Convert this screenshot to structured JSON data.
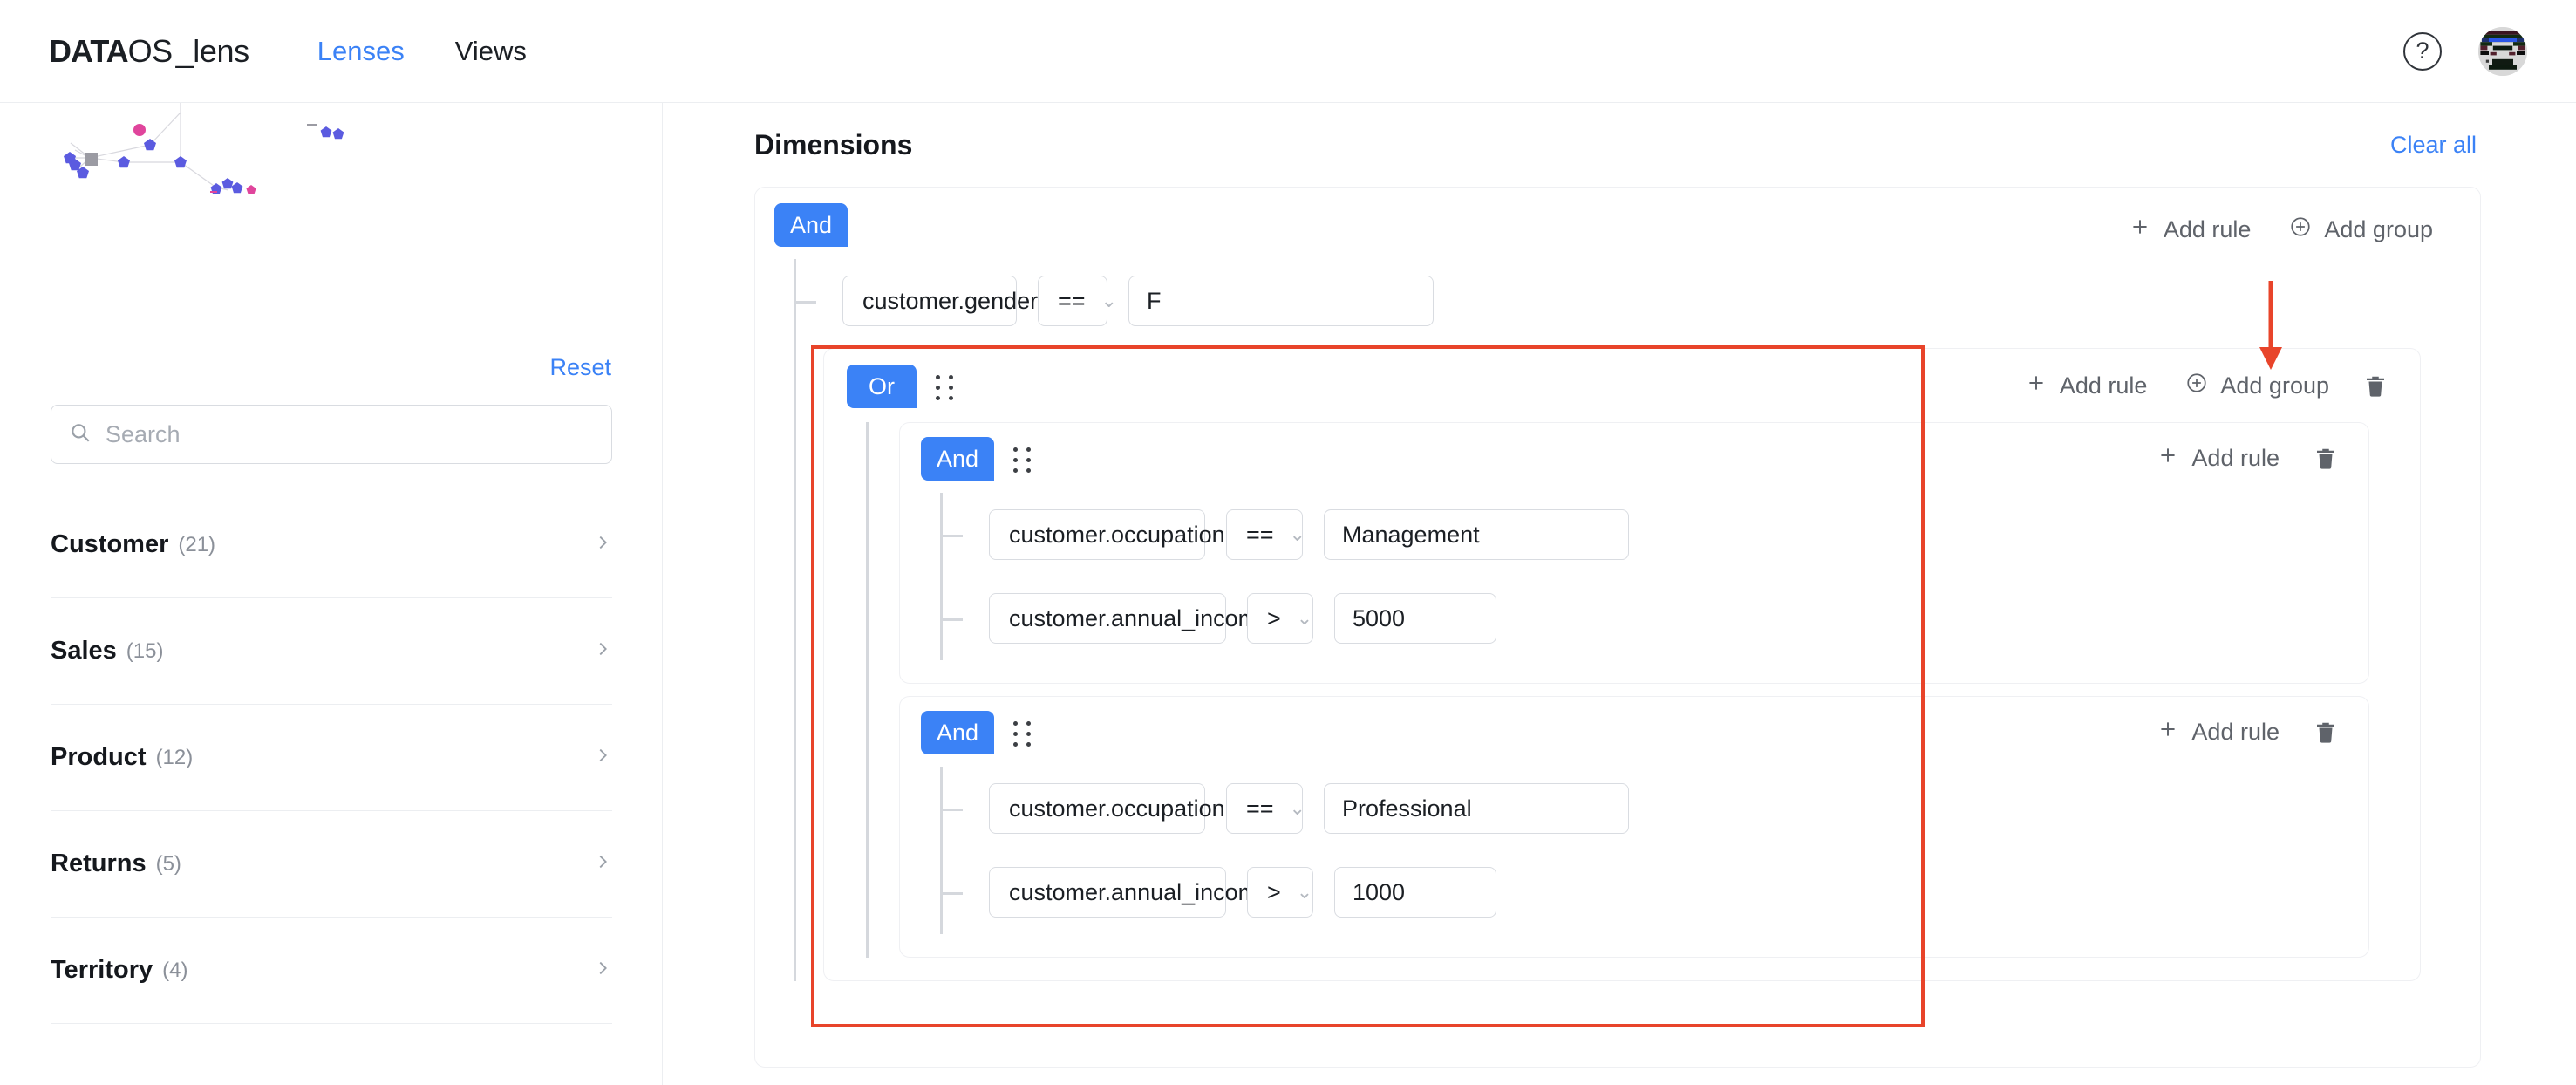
{
  "header": {
    "brand": {
      "data": "DATA",
      "os": "OS",
      "lens": "_lens"
    },
    "nav": [
      {
        "label": "Lenses",
        "active": true
      },
      {
        "label": "Views",
        "active": false
      }
    ],
    "help_icon": "question-mark-circle-icon",
    "help_glyph": "?",
    "avatar_icon": "user-avatar-identicon"
  },
  "sidebar": {
    "reset_label": "Reset",
    "search": {
      "placeholder": "Search",
      "value": "",
      "icon": "search-icon"
    },
    "items": [
      {
        "label": "Customer",
        "count": "(21)"
      },
      {
        "label": "Sales",
        "count": "(15)"
      },
      {
        "label": "Product",
        "count": "(12)"
      },
      {
        "label": "Returns",
        "count": "(5)"
      },
      {
        "label": "Territory",
        "count": "(4)"
      }
    ],
    "chevron_icon": "chevron-right-icon"
  },
  "main": {
    "title": "Dimensions",
    "clear_all_label": "Clear all",
    "labels": {
      "add_rule": "Add rule",
      "add_group": "Add group",
      "plus_icon": "plus-icon",
      "plus_circle_icon": "plus-circle-icon",
      "trash_icon": "trash-icon",
      "drag_icon": "drag-handle-icon",
      "caret_icon": "chevron-down-icon"
    },
    "root_group": {
      "operator": "And",
      "rules": [
        {
          "field": "customer.gender",
          "operator": "==",
          "value": "F",
          "value_type": "text"
        }
      ]
    },
    "or_group": {
      "operator": "Or",
      "subgroups": [
        {
          "operator": "And",
          "rules": [
            {
              "field": "customer.occupation",
              "operator": "==",
              "value": "Management",
              "value_type": "text"
            },
            {
              "field": "customer.annual_income",
              "operator": ">",
              "value": "5000",
              "value_type": "number"
            }
          ]
        },
        {
          "operator": "And",
          "rules": [
            {
              "field": "customer.occupation",
              "operator": "==",
              "value": "Professional",
              "value_type": "text"
            },
            {
              "field": "customer.annual_income",
              "operator": ">",
              "value": "1000",
              "value_type": "number"
            }
          ]
        }
      ]
    }
  },
  "annotation": {
    "highlight_color": "#e8442a",
    "arrow_color": "#e8442a",
    "target": "Add group"
  },
  "colors": {
    "accent": "#3b82f6",
    "badge": "#3b82f6",
    "text": "#15181d",
    "muted": "#8b9099",
    "border": "#d9dce1",
    "annotation": "#e8442a"
  }
}
